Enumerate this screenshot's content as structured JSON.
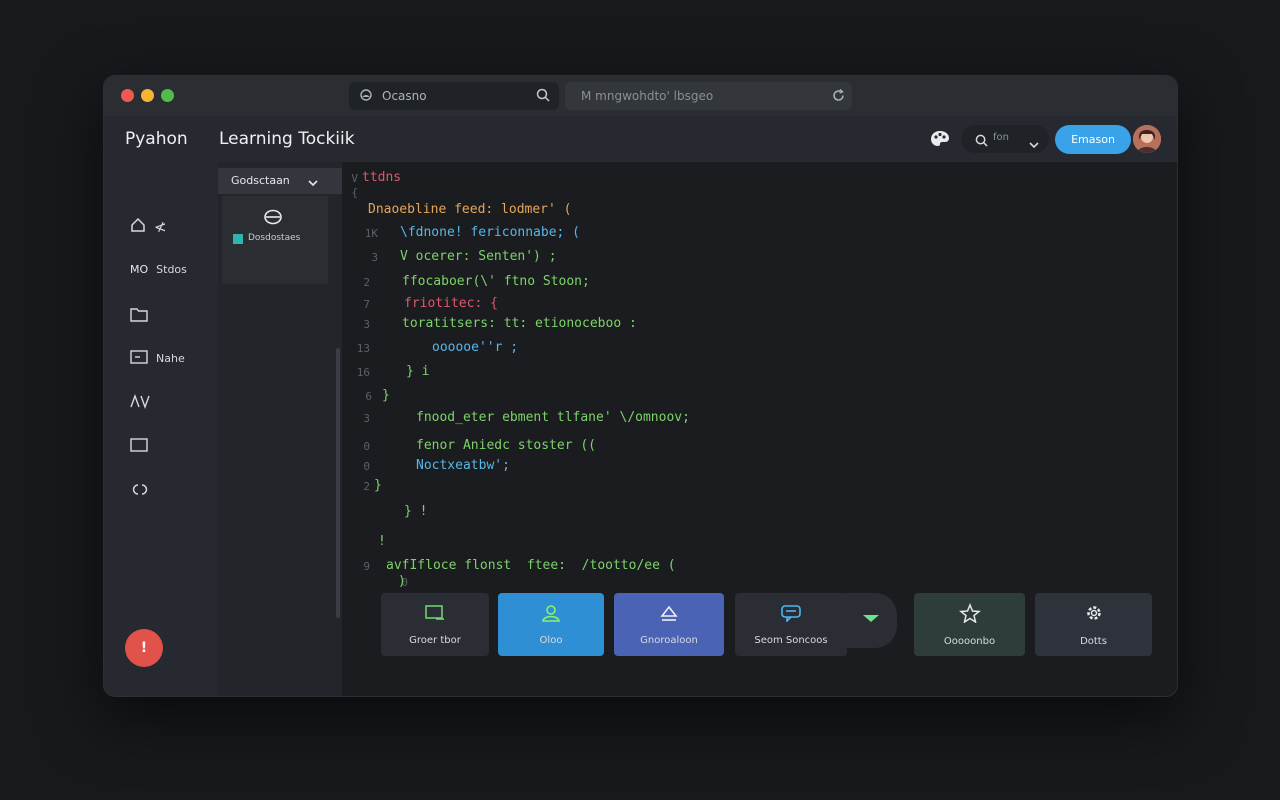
{
  "browser": {
    "tab_label": "Ocasno",
    "address": "M mngwohdto' lbsgeo"
  },
  "app": {
    "title_primary": "Pyahon",
    "title_secondary": "Learning Tockiik",
    "search_label": "fon",
    "primary_button": "Emason"
  },
  "sidebar": {
    "items": [
      {
        "icon": "home-icon",
        "label": "≮"
      },
      {
        "icon": "mo-icon",
        "prefix": "MO",
        "label": "Stdos"
      },
      {
        "icon": "folder-icon",
        "label": ""
      },
      {
        "icon": "notes-icon",
        "label": "Nahe"
      },
      {
        "icon": "diff-icon",
        "label": ""
      },
      {
        "icon": "window-icon",
        "label": ""
      },
      {
        "icon": "link-icon",
        "label": ""
      }
    ],
    "user_badge": "!"
  },
  "panel": {
    "dropdown_label": "Godsctaan",
    "item_label": "Dosdostaes"
  },
  "code": {
    "lines": [
      {
        "ln": "V",
        "text": "ttdns",
        "color": "#e0566a"
      },
      {
        "ln": "{",
        "text": "",
        "color": "#8fd36a"
      },
      {
        "ln": "",
        "text": "Dnaoebline feed: lodmer' (",
        "color": "#e6a55a"
      },
      {
        "ln": "1K",
        "text": "\\fdnone! fericonnabe; (",
        "color": "#58b6e8"
      },
      {
        "ln": "3",
        "text": "V ocerer: Senten') ;",
        "color": "#7dd36a"
      },
      {
        "ln": "2",
        "text": "ffocaboer(\\' ftno Stoon;",
        "color": "#7dd36a"
      },
      {
        "ln": "7",
        "text": "friotitec: {",
        "color": "#e0566a"
      },
      {
        "ln": "3",
        "text": "toratitsers: tt: etionoceboo :",
        "color": "#7dd36a"
      },
      {
        "ln": "13",
        "text": "oooooe''r ;",
        "color": "#58b6e8"
      },
      {
        "ln": "16",
        "text": "} i",
        "color": "#7dd36a"
      },
      {
        "ln": "6",
        "text": "}",
        "color": "#7dd36a"
      },
      {
        "ln": "3",
        "text": "fnood_eter ebment tlfane' \\/omnoov;",
        "color": "#7dd36a"
      },
      {
        "ln": "0",
        "text": "fenor Aniedc stoster ((",
        "color": "#7dd36a"
      },
      {
        "ln": "0",
        "text": "Noctxeatbw';",
        "color": "#58b6e8"
      },
      {
        "ln": "2",
        "text": "}",
        "color": "#7dd36a"
      },
      {
        "ln": "",
        "text": "} !",
        "color": "#7dd36a"
      },
      {
        "ln": "",
        "text": "!",
        "color": "#7dd36a"
      },
      {
        "ln": "9",
        "text": "avfIfloce flonst  ftee:  /tootto/ee (",
        "color": "#7dd36a"
      },
      {
        "ln": "0",
        "text": ")",
        "color": "#7dd36a"
      }
    ]
  },
  "actions": [
    {
      "label": "Groer tbor",
      "icon": "terminal-icon",
      "bg": "#2a2e34"
    },
    {
      "label": "Oloo",
      "icon": "user-icon",
      "bg": "#2f8fd4"
    },
    {
      "label": "Gnoroaloon",
      "icon": "eject-icon",
      "bg": "#4a63b5"
    },
    {
      "label": "Seom Soncoos",
      "icon": "chat-icon",
      "bg": "#2a2e34"
    },
    {
      "label": "",
      "icon": "chevron-down-icon",
      "bg": "#2a2e34"
    },
    {
      "label": "Ooooonbo",
      "icon": "star-icon",
      "bg": "#2f3d3a"
    },
    {
      "label": "Dotts",
      "icon": "gear-icon",
      "bg": "#2e323a"
    }
  ]
}
